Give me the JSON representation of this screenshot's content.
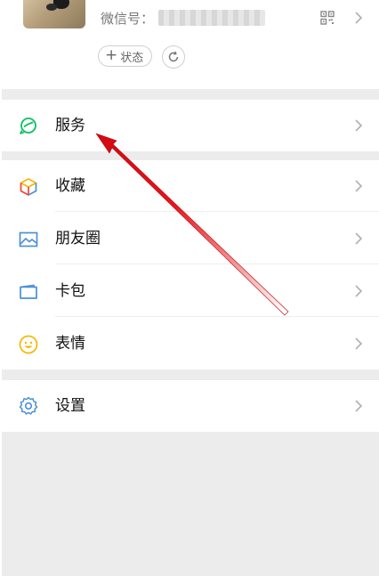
{
  "profile": {
    "wechat_id_label": "微信号：",
    "status_button_label": "状态",
    "status_button_prefix": "+"
  },
  "menu": {
    "services": "服务",
    "favorites": "收藏",
    "moments": "朋友圈",
    "cards": "卡包",
    "stickers": "表情",
    "settings": "设置"
  },
  "colors": {
    "accent_green": "#07c160",
    "icon_blue": "#4a90d9",
    "icon_yellow": "#f5b800",
    "annotation_red": "#e8141b",
    "separator_gray": "#ececec"
  }
}
